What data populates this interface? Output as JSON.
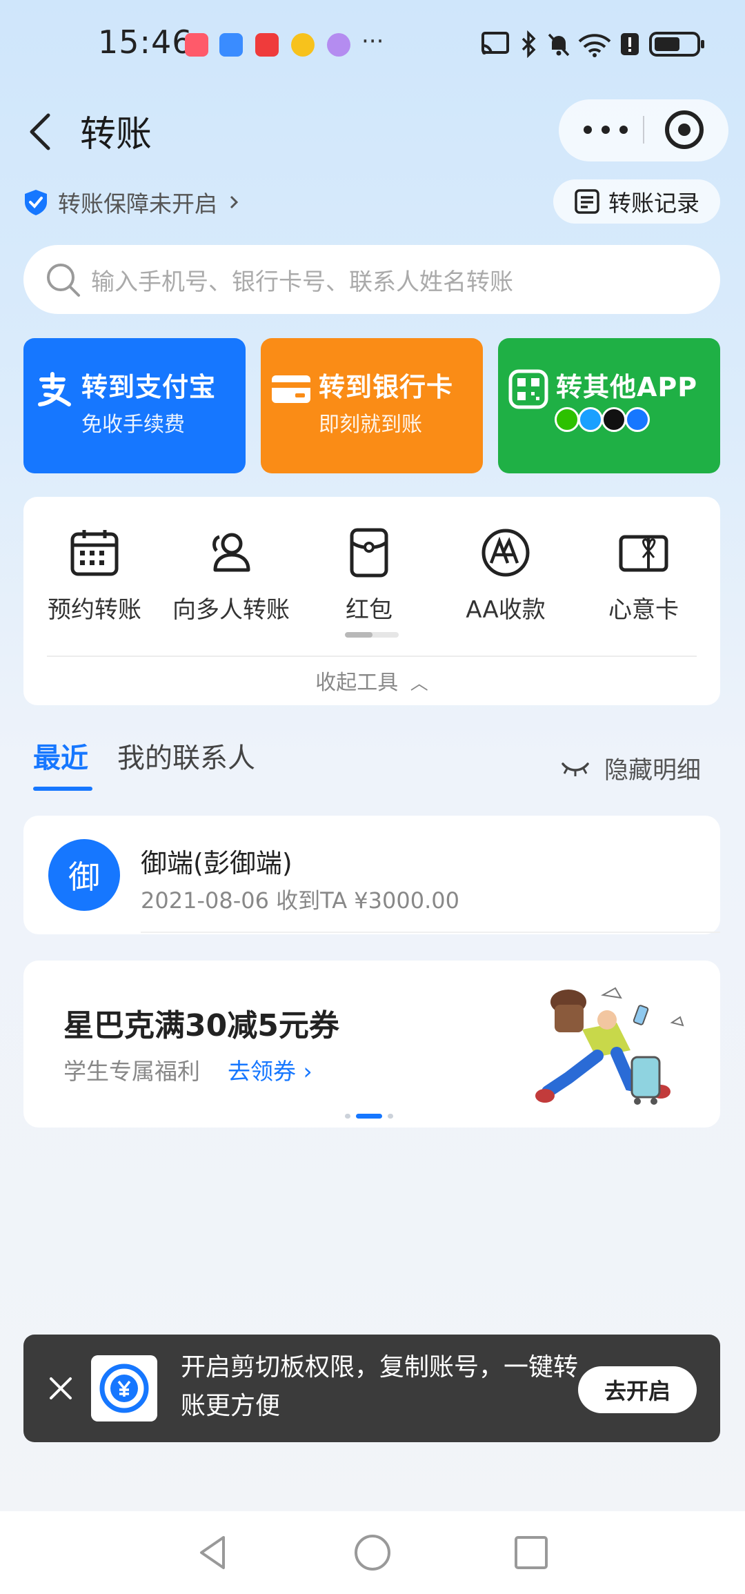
{
  "status_bar": {
    "time": "15:46",
    "more_glyph": "···",
    "left_icons": [
      "book-app-icon",
      "cloud-app-icon",
      "red-envelope-app-icon",
      "weibo-app-icon",
      "purple-app-icon"
    ],
    "right_icons": [
      "cast-icon",
      "bluetooth-icon",
      "bell-muted-icon",
      "wifi-icon",
      "alert-icon",
      "battery-icon"
    ]
  },
  "header": {
    "title": "转账"
  },
  "protection": {
    "label": "转账保障未开启",
    "record_label": "转账记录"
  },
  "search": {
    "placeholder": "输入手机号、银行卡号、联系人姓名转账"
  },
  "transfer_cards": [
    {
      "title": "转到支付宝",
      "subtitle": "免收手续费",
      "color": "#1677ff"
    },
    {
      "title": "转到银行卡",
      "subtitle": "即刻就到账",
      "color": "#fa8c16"
    },
    {
      "title": "转其他APP",
      "subtitle": "",
      "color": "#1fb045"
    }
  ],
  "tools": {
    "items": [
      {
        "label": "预约转账",
        "icon": "calendar-icon"
      },
      {
        "label": "向多人转账",
        "icon": "people-icon"
      },
      {
        "label": "红包",
        "icon": "red-packet-icon"
      },
      {
        "label": "AA收款",
        "icon": "aa-icon"
      },
      {
        "label": "心意卡",
        "icon": "gift-card-icon"
      }
    ],
    "collapse_label": "收起工具"
  },
  "tabs": {
    "recent": "最近",
    "contacts": "我的联系人",
    "hide_detail": "隐藏明细"
  },
  "recent_contacts": [
    {
      "avatar_char": "御",
      "name": "御端(彭御端)",
      "detail": "2021-08-06 收到TA ¥3000.00"
    }
  ],
  "promo": {
    "title": "星巴克满30减5元券",
    "subtitle": "学生专属福利",
    "link": "去领券"
  },
  "clipboard_banner": {
    "text": "开启剪切板权限，复制账号，一键转账更方便",
    "button": "去开启"
  },
  "colors": {
    "accent": "#1677ff",
    "orange": "#fa8c16",
    "green": "#1fb045",
    "banner_bg": "#3b3b3b"
  }
}
